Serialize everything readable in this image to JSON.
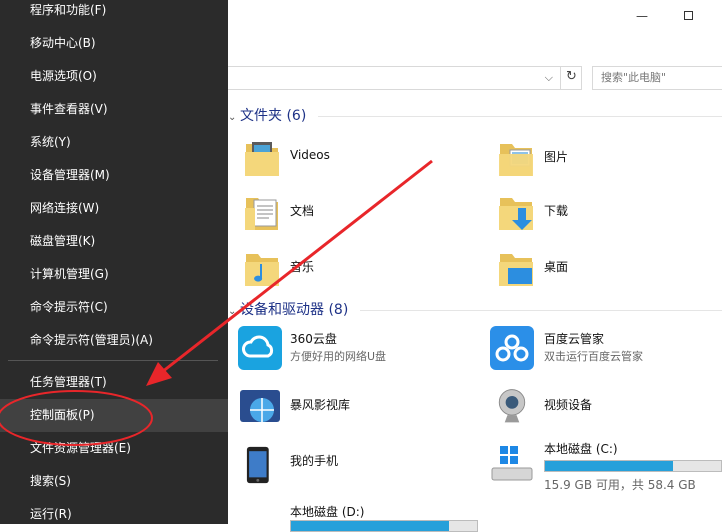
{
  "menu": {
    "items": [
      {
        "label": "程序和功能(F)"
      },
      {
        "label": "移动中心(B)"
      },
      {
        "label": "电源选项(O)"
      },
      {
        "label": "事件查看器(V)"
      },
      {
        "label": "系统(Y)"
      },
      {
        "label": "设备管理器(M)"
      },
      {
        "label": "网络连接(W)"
      },
      {
        "label": "磁盘管理(K)"
      },
      {
        "label": "计算机管理(G)"
      },
      {
        "label": "命令提示符(C)"
      },
      {
        "label": "命令提示符(管理员)(A)"
      },
      {
        "label": "任务管理器(T)"
      },
      {
        "label": "控制面板(P)"
      },
      {
        "label": "文件资源管理器(E)"
      },
      {
        "label": "搜索(S)"
      },
      {
        "label": "运行(R)"
      }
    ],
    "highlighted": "控制面板(P)"
  },
  "explorer": {
    "search_placeholder": "搜索\"此电脑\"",
    "folders_header": "文件夹 (6)",
    "drives_header": "设备和驱动器 (8)",
    "folders": [
      {
        "name": "Videos"
      },
      {
        "name": "图片"
      },
      {
        "name": "文档"
      },
      {
        "name": "下载"
      },
      {
        "name": "音乐"
      },
      {
        "name": "桌面"
      }
    ],
    "devices": [
      {
        "name": "360云盘",
        "sub": "方便好用的网络U盘"
      },
      {
        "name": "百度云管家",
        "sub": "双击运行百度云管家"
      },
      {
        "name": "暴风影视库",
        "sub": ""
      },
      {
        "name": "视频设备",
        "sub": ""
      },
      {
        "name": "我的手机",
        "sub": ""
      }
    ],
    "drive_c": {
      "name": "本地磁盘 (C:)",
      "free_text": "15.9 GB 可用，共 58.4 GB",
      "used_fraction": 0.73
    },
    "drive_d": {
      "name": "本地磁盘 (D:)",
      "used_fraction": 0.85
    }
  },
  "colors": {
    "menu_bg": "#2b2b2b",
    "menu_hover": "#414141",
    "header": "#1e3287",
    "drive_fill": "#26a0da",
    "annotation": "#e8262a"
  }
}
